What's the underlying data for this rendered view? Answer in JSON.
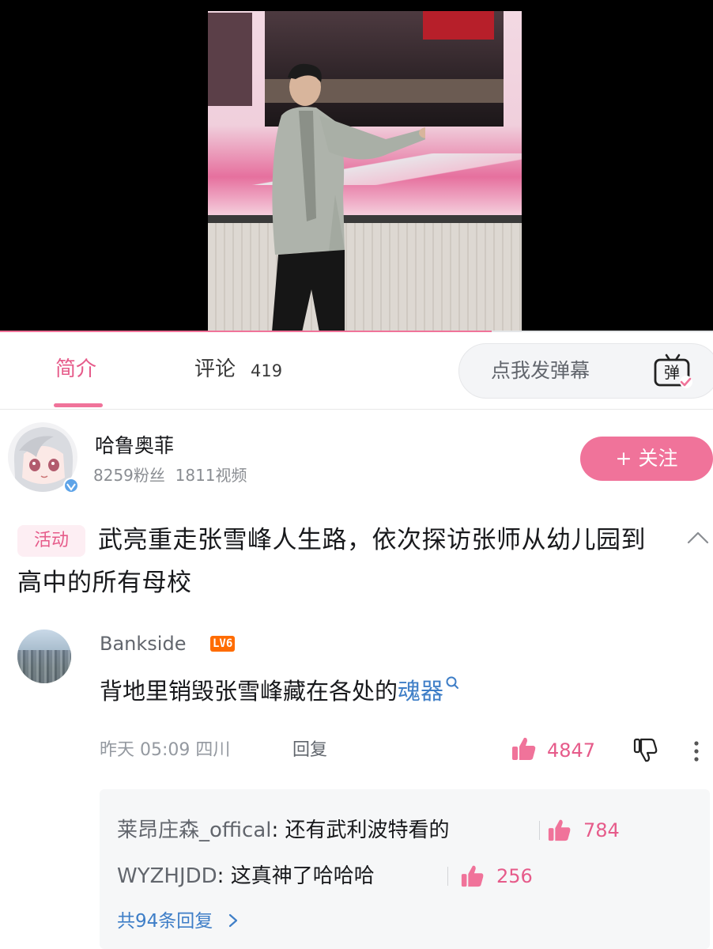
{
  "player": {
    "progress_fraction": 0.69
  },
  "tabs": {
    "intro_label": "简介",
    "comments_label": "评论",
    "comments_count": "419",
    "danmaku_placeholder": "点我发弹幕",
    "danmaku_icon_text": "弹"
  },
  "uploader": {
    "name": "哈鲁奥菲",
    "fans": "8259粉丝",
    "videos": "1811视频",
    "follow_label": "+ 关注"
  },
  "video": {
    "badge": "活动",
    "title": "武亮重走张雪峰人生路，依次探访张师从幼儿园到高中的所有母校"
  },
  "comment": {
    "username": "Bankside",
    "level": "LV6",
    "text_before_link": "背地里销毁张雪峰藏在各处的",
    "link_text": "魂器",
    "time": "昨天 05:09",
    "location": "四川",
    "reply_label": "回复",
    "likes": "4847",
    "replies": [
      {
        "user": "莱昂庄森_offical",
        "text": ": 还有武利波特看的",
        "likes": "784"
      },
      {
        "user": "WYZHJDD",
        "text": ": 这真神了哈哈哈",
        "likes": "256"
      }
    ],
    "replies_more": "共94条回复"
  },
  "colors": {
    "accent": "#f0739a",
    "link": "#3e7ec7",
    "level_badge": "#ff6c00"
  },
  "icons": [
    "danmaku-icon",
    "chevron-up-icon",
    "search-icon",
    "thumbs-up-icon",
    "thumbs-down-icon",
    "more-vertical-icon",
    "chevron-right-icon"
  ]
}
